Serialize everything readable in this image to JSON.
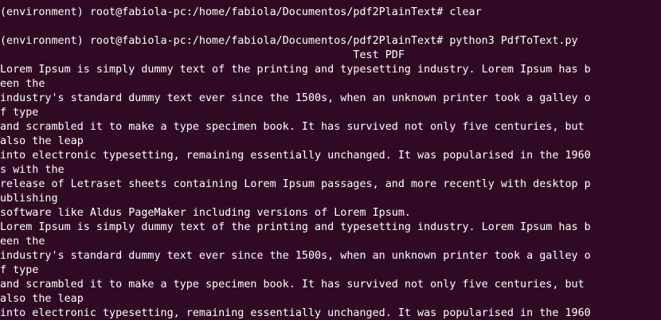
{
  "terminal": {
    "colors": {
      "background": "#300a24",
      "foreground": "#ffffff"
    },
    "lines": [
      "(environment) root@fabiola-pc:/home/fabiola/Documentos/pdf2PlainText# clear",
      "",
      "(environment) root@fabiola-pc:/home/fabiola/Documentos/pdf2PlainText# python3 PdfToText.py",
      "                                                       Test PDF",
      "Lorem Ipsum is simply dummy text of the printing and typesetting industry. Lorem Ipsum has b",
      "een the",
      "industry's standard dummy text ever since the 1500s, when an unknown printer took a galley o",
      "f type",
      "and scrambled it to make a type specimen book. It has survived not only five centuries, but",
      "also the leap",
      "into electronic typesetting, remaining essentially unchanged. It was popularised in the 1960",
      "s with the",
      "release of Letraset sheets containing Lorem Ipsum passages, and more recently with desktop p",
      "ublishing",
      "software like Aldus PageMaker including versions of Lorem Ipsum.",
      "Lorem Ipsum is simply dummy text of the printing and typesetting industry. Lorem Ipsum has b",
      "een the",
      "industry's standard dummy text ever since the 1500s, when an unknown printer took a galley o",
      "f type",
      "and scrambled it to make a type specimen book. It has survived not only five centuries, but",
      "also the leap",
      "into electronic typesetting, remaining essentially unchanged. It was popularised in the 1960"
    ]
  }
}
